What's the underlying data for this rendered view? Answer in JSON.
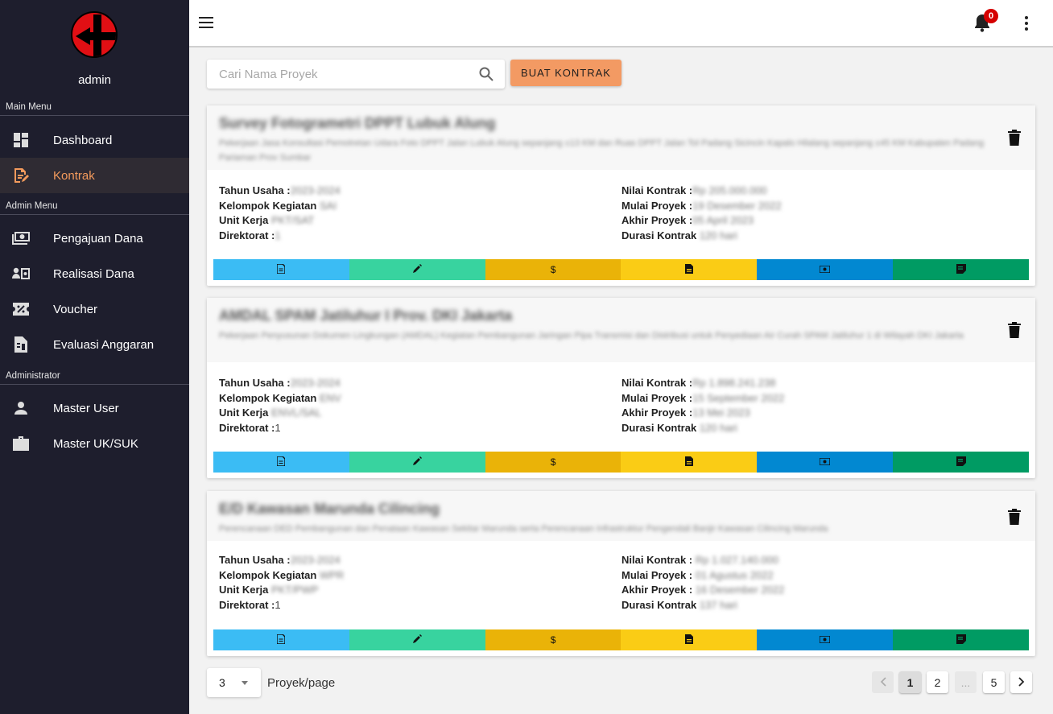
{
  "sidebar": {
    "user": "admin",
    "sections": {
      "main": "Main Menu",
      "admin": "Admin Menu",
      "administrator": "Administrator"
    },
    "items": [
      {
        "label": "Dashboard",
        "icon": "dashboard-icon"
      },
      {
        "label": "Kontrak",
        "icon": "contract-edit-icon",
        "active": true
      },
      {
        "label": "Pengajuan Dana",
        "icon": "money-icon"
      },
      {
        "label": "Realisasi Dana",
        "icon": "fund-realization-icon"
      },
      {
        "label": "Voucher",
        "icon": "voucher-icon"
      },
      {
        "label": "Evaluasi Anggaran",
        "icon": "budget-evaluation-icon"
      },
      {
        "label": "Master User",
        "icon": "person-icon"
      },
      {
        "label": "Master UK/SUK",
        "icon": "briefcase-icon"
      }
    ]
  },
  "topbar": {
    "notification_count": "0"
  },
  "search": {
    "placeholder": "Cari Nama Proyek"
  },
  "create_button": "BUAT KONTRAK",
  "labels": {
    "tahun_usaha": "Tahun Usaha :",
    "kelompok_kegiatan": "Kelompok Kegiatan",
    "unit_kerja": "Unit Kerja",
    "direktorat": "Direktorat :",
    "nilai_kontrak": "Nilai Kontrak :",
    "mulai_proyek": "Mulai Proyek :",
    "akhir_proyek": "Akhir Proyek :",
    "durasi_kontrak": "Durasi Kontrak"
  },
  "projects": [
    {
      "title": "Survey Fotogrametri DPPT Lubuk Alung",
      "description": "Pekerjaan Jasa Konsultasi Pemotretan Udara Foto DPPT Jalan Lubuk Alung sepanjang ±13 KM dan Ruas DPPT Jalan Tol Padang Sicincin Kapalo Hilalang sepanjang ±45 KM Kabupaten Padang Pariaman Prov Sumbar",
      "tahun_usaha": "2023-2024",
      "kelompok_kegiatan": "SAI",
      "unit_kerja": "PKT/SAT",
      "direktorat": "1",
      "nilai_kontrak": "Rp 205.000.000",
      "mulai_proyek": "19 Desember 2022",
      "akhir_proyek": "05 April 2023",
      "durasi_kontrak": "120 hari"
    },
    {
      "title": "AMDAL SPAM Jatiluhur I Prov. DKI Jakarta",
      "description": "Pekerjaan Penyusunan Dokumen Lingkungan (AMDAL) Kegiatan Pembangunan Jaringan Pipa Transmisi dan Distribusi untuk Penyediaan Air Curah SPAM Jatiluhur 1 di Wilayah DKI Jakarta",
      "tahun_usaha": "2023-2024",
      "kelompok_kegiatan": "ENV",
      "unit_kerja": "ENVL/SAL",
      "direktorat": "1",
      "nilai_kontrak": "Rp 1.898.241.238",
      "mulai_proyek": "15 September 2022",
      "akhir_proyek": "13 Mei 2023",
      "durasi_kontrak": "120 hari"
    },
    {
      "title": "E/D Kawasan Marunda Cilincing",
      "description": "Perencanaan DED Pembangunan dan Penataan Kawasan Sekitar Marunda serta Perencanaan Infrastruktur Pengendali Banjir Kawasan Cilincing Marunda",
      "tahun_usaha": "2023-2024",
      "kelompok_kegiatan": "WPR",
      "unit_kerja": "PKT/PWP",
      "direktorat": "1",
      "nilai_kontrak": "Rp 1.027.140.000",
      "mulai_proyek": "01 Agustus 2022",
      "akhir_proyek": "16 Desember 2022",
      "durasi_kontrak": "137 hari"
    }
  ],
  "action_icons": [
    "document-icon",
    "edit-pencil-icon",
    "dollar-icon",
    "file-icon",
    "money-icon",
    "notes-icon"
  ],
  "pagination": {
    "per_page": "3",
    "per_page_label": "Proyek/page",
    "pages": [
      "1",
      "2",
      "...",
      "5"
    ],
    "current": "1"
  },
  "colors": {
    "sidebar_bg": "#1e1e2d",
    "accent": "#f39a5c",
    "action_colors": [
      "#3bbcf4",
      "#38d39f",
      "#eab308",
      "#facc15",
      "#0288d1",
      "#009b63"
    ]
  }
}
